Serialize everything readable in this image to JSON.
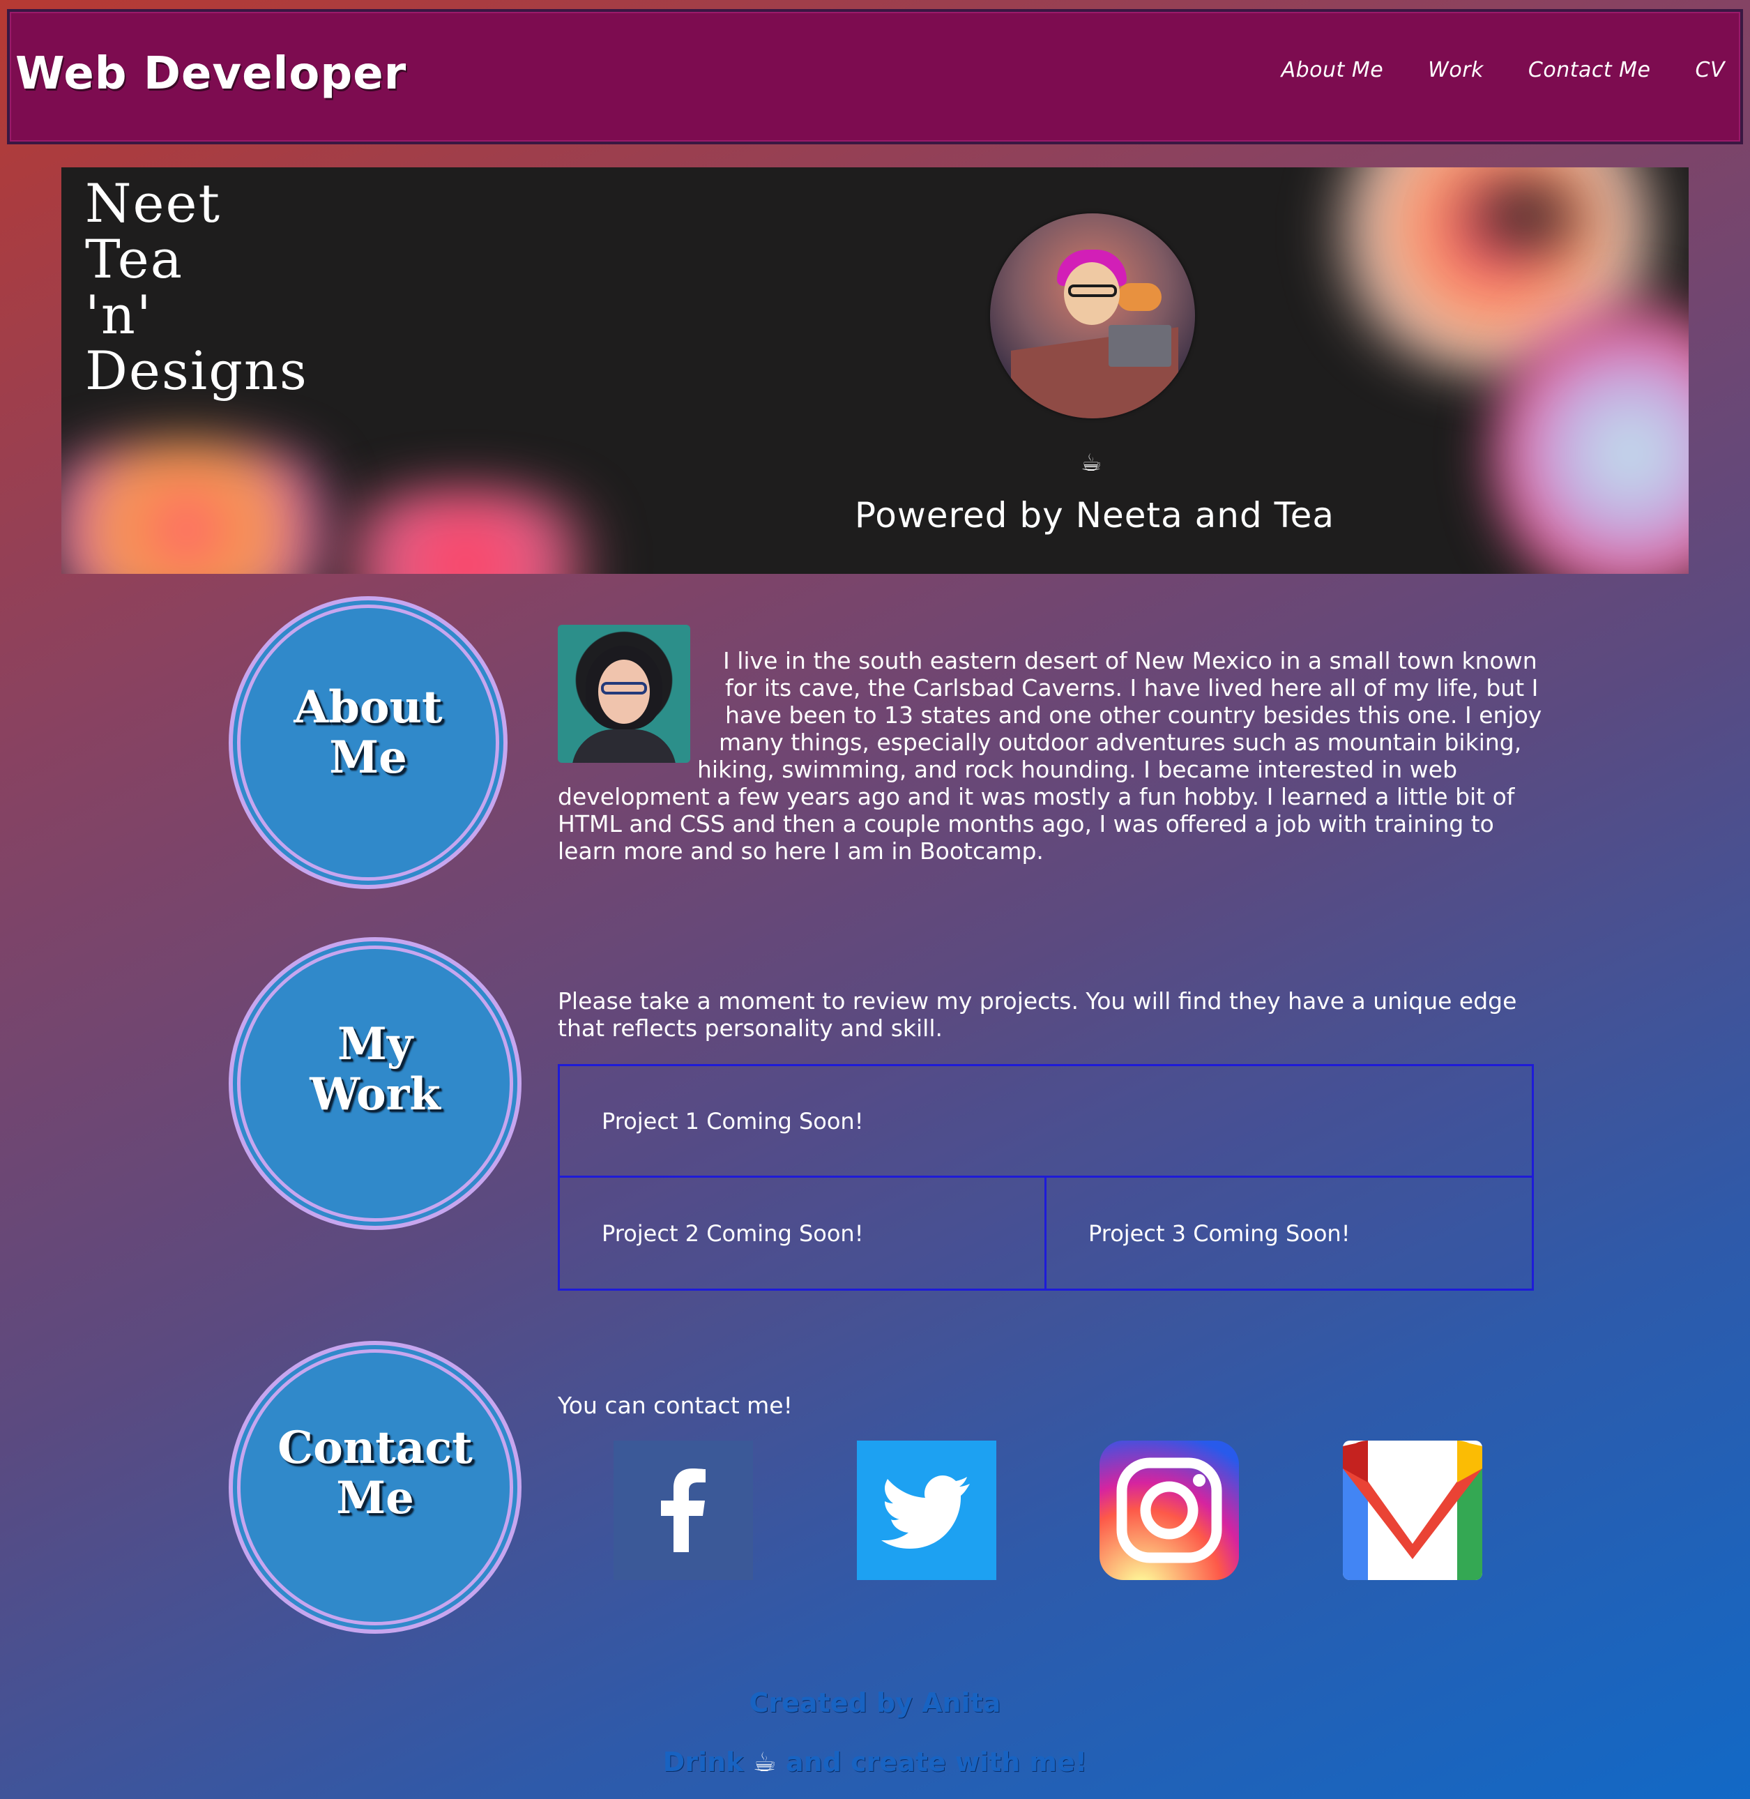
{
  "header": {
    "brand": "Web Developer",
    "nav": [
      "About Me",
      "Work",
      "Contact Me",
      "CV"
    ]
  },
  "hero": {
    "logo_lines": [
      "Neet",
      "Tea",
      "'n'",
      "Designs"
    ],
    "tea_icon": "☕",
    "tagline": "Powered by Neeta and Tea"
  },
  "about": {
    "badge_lines": [
      "About",
      "Me"
    ],
    "text_lines": [
      "I live in the south eastern desert of New Mexico in a small town known",
      "for its cave, the Carlsbad Caverns. I have lived here all of my life, but I",
      "have been to 13 states and one other country besides this one. I enjoy",
      "many things, especially outdoor adventures such as mountain biking,",
      "hiking, swimming, and rock hounding. I became interested in web",
      "development a few years ago and it was mostly a fun hobby. I learned a little bit of",
      "HTML and CSS and then a couple months ago, I was offered a job with training to",
      "learn more and so here I am in Bootcamp."
    ]
  },
  "work": {
    "badge_lines": [
      "My",
      "Work"
    ],
    "intro": "Please take a moment to review my projects. You will find they have a unique edge that reflects personality and skill.",
    "projects": [
      "Project 1 Coming Soon!",
      "Project 2 Coming Soon!",
      "Project 3 Coming Soon!"
    ],
    "border_color": "#1e1bd8"
  },
  "contact": {
    "badge_lines": [
      "Contact",
      "Me"
    ],
    "intro": "You can contact me!",
    "social": [
      "facebook-icon",
      "twitter-icon",
      "instagram-icon",
      "gmail-icon"
    ]
  },
  "footer": {
    "credit": "Created by Anita",
    "tagline_before": "Drink",
    "tagline_icon": "☕",
    "tagline_after": "and create with me!"
  },
  "colors": {
    "header_bg": "#7d0c50",
    "badge_bg": "#3089ca",
    "badge_ring": "#c7a6ef",
    "footer_text": "#1863c2"
  }
}
